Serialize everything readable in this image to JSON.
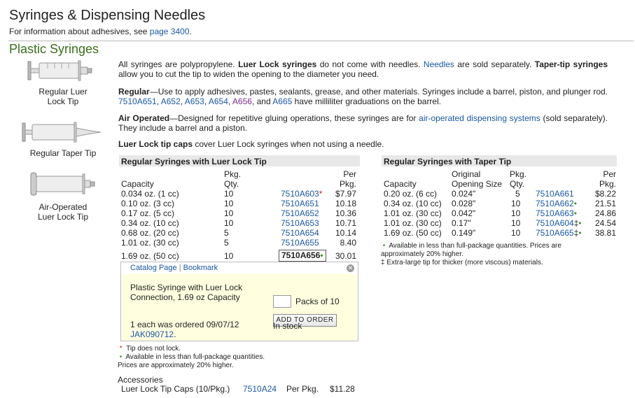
{
  "header": {
    "title": "Syringes & Dispensing Needles",
    "note_prefix": "For information about adhesives, see ",
    "note_link": "page 3400",
    "note_suffix": "."
  },
  "section": {
    "title": "Plastic Syringes"
  },
  "images": [
    {
      "label_line1": "Regular Luer",
      "label_line2": "Lock Tip",
      "icon": "luer-lock-syringe-icon"
    },
    {
      "label_line1": "Regular Taper Tip",
      "label_line2": "",
      "icon": "taper-tip-syringe-icon"
    },
    {
      "label_line1": "Air-Operated",
      "label_line2": "Luer Lock Tip",
      "icon": "air-operated-syringe-icon"
    }
  ],
  "description": {
    "p1_a": "All syringes are polypropylene. ",
    "p1_b": "Luer Lock syringes",
    "p1_c": " do not come with needles. ",
    "p1_link": "Needles",
    "p1_d": " are sold separately. ",
    "p1_e": "Taper-tip syringes",
    "p1_f": " allow you to cut the tip to widen the opening to the diameter you need.",
    "p2_a": "Regular",
    "p2_b": "—Use to apply adhesives, pastes, sealants, grease, and other materials. Syringes include a barrel, piston, and plunger rod. ",
    "p2_links": [
      "7510A651",
      "A652",
      "A653",
      "A654",
      "A656"
    ],
    "p2_and": "and",
    "p2_last": "A665",
    "p2_c": " have milliliter graduations on the barrel.",
    "p3_a": "Air Operated",
    "p3_b": "—Designed for repetitive gluing operations, these syringes are for ",
    "p3_link": "air-operated dispensing systems",
    "p3_c": " (sold separately). They include a barrel and a piston.",
    "p4_a": "Luer Lock tip caps",
    "p4_b": " cover Luer Lock syringes when not using a needle."
  },
  "luer_table": {
    "title": "Regular Syringes with Luer Lock Tip",
    "headers": {
      "capacity": "Capacity",
      "pkg_qty_1": "Pkg.",
      "pkg_qty_2": "Qty.",
      "per_pkg_1": "Per",
      "per_pkg_2": "Pkg."
    },
    "rows": [
      {
        "capacity": "0.034 oz. (1 cc)",
        "qty": "10",
        "part": "7510A603",
        "mark": "*",
        "price": "$7.97"
      },
      {
        "capacity": "0.10 oz. (3 cc)",
        "qty": "10",
        "part": "7510A651",
        "mark": "",
        "price": "10.18"
      },
      {
        "capacity": "0.17 oz. (5 cc)",
        "qty": "10",
        "part": "7510A652",
        "mark": "",
        "price": "10.36"
      },
      {
        "capacity": "0.34 oz. (10 cc)",
        "qty": "10",
        "part": "7510A653",
        "mark": "",
        "price": "10.71"
      },
      {
        "capacity": "0.68 oz. (20 cc)",
        "qty": "5",
        "part": "7510A654",
        "mark": "",
        "price": "10.14"
      },
      {
        "capacity": "1.01 oz. (30 cc)",
        "qty": "5",
        "part": "7510A655",
        "mark": "",
        "price": "8.40"
      },
      {
        "capacity": "1.69 oz. (50 cc)",
        "qty": "10",
        "part": "7510A656",
        "mark": "•",
        "price": "30.01"
      }
    ]
  },
  "popup": {
    "catalog_link": "Catalog Page",
    "bookmark_link": "Bookmark",
    "desc_line1": "Plastic Syringe with Luer Lock",
    "desc_line2": "Connection, 1.69 oz Capacity",
    "qty_value": "",
    "packs_label": "Packs of 10",
    "order_button": "ADD TO ORDER",
    "ordered_note": "1 each was ordered 09/07/12",
    "order_link": "JAK090712",
    "order_suffix": ".",
    "stock": "In stock"
  },
  "luer_notes": {
    "note1_mark": "*",
    "note1": "Tip does not lock.",
    "note2_mark": "•",
    "note2": "Available in less than full-package quantities.",
    "note3": "Prices are approximately 20% higher."
  },
  "accessories": {
    "title": "Accessories",
    "item": "Luer Lock Tip Caps (10/Pkg.)",
    "part": "7510A24",
    "per_pkg": "Per Pkg.",
    "price": "$11.28"
  },
  "taper_table": {
    "title": "Regular Syringes with Taper Tip",
    "headers": {
      "capacity": "Capacity",
      "orig_1": "Original",
      "orig_2": "Opening Size",
      "pkg_qty_1": "Pkg.",
      "pkg_qty_2": "Qty.",
      "per_pkg_1": "Per",
      "per_pkg_2": "Pkg."
    },
    "rows": [
      {
        "capacity": "0.20 oz. (6 cc)",
        "opening": "0.024\"",
        "qty": "5",
        "part": "7510A661",
        "mark": "",
        "price": "$8.22"
      },
      {
        "capacity": "0.34 oz. (10 cc)",
        "opening": "0.028\"",
        "qty": "10",
        "part": "7510A662",
        "mark": "•",
        "price": "21.51"
      },
      {
        "capacity": "1.01 oz. (30 cc)",
        "opening": "0.042\"",
        "qty": "10",
        "part": "7510A663",
        "mark": "•",
        "price": "24.86"
      },
      {
        "capacity": "1.01 oz. (30 cc)",
        "opening": "0.17\"",
        "qty": "10",
        "part": "7510A604",
        "mark": "‡•",
        "price": "24.54"
      },
      {
        "capacity": "1.69 oz. (50 cc)",
        "opening": "0.149\"",
        "qty": "10",
        "part": "7510A665",
        "mark": "‡•",
        "price": "38.81"
      }
    ],
    "note1_mark": "•",
    "note1_line1": "Available in less than full-package quantities. Prices are",
    "note1_line2": "approximately 20% higher.",
    "note2_mark": "‡",
    "note2": "Extra-large tip for thicker (more viscous) materials."
  },
  "colors": {
    "link": "#1a57a5",
    "section_green": "#3a6e1c",
    "popup_bg": "#ffffe0",
    "bullet_green": "#3a9b2a",
    "asterisk_red": "#c02020"
  }
}
